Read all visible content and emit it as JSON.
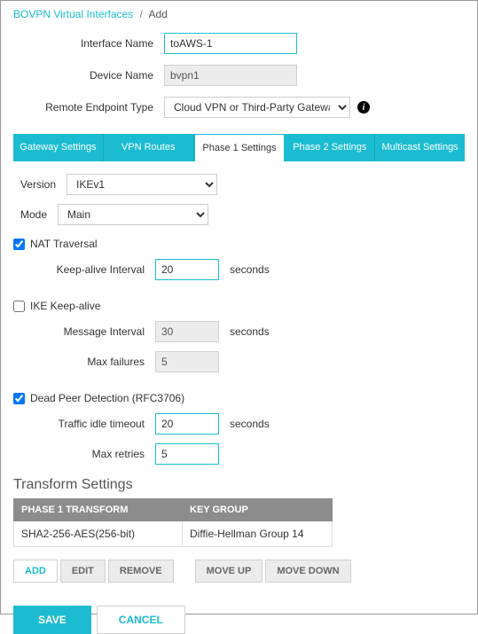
{
  "breadcrumb": {
    "root": "BOVPN Virtual Interfaces",
    "current": "Add"
  },
  "header_form": {
    "interface_name_label": "Interface Name",
    "interface_name_value": "toAWS-1",
    "device_name_label": "Device Name",
    "device_name_value": "bvpn1",
    "remote_endpoint_label": "Remote Endpoint Type",
    "remote_endpoint_value": "Cloud VPN or Third-Party Gateway"
  },
  "tabs": {
    "gateway": "Gateway Settings",
    "vpn_routes": "VPN Routes",
    "phase1": "Phase 1 Settings",
    "phase2": "Phase 2 Settings",
    "multicast": "Multicast Settings"
  },
  "phase1": {
    "version_label": "Version",
    "version_value": "IKEv1",
    "mode_label": "Mode",
    "mode_value": "Main",
    "nat_traversal": {
      "label": "NAT Traversal",
      "checked": true,
      "keep_alive_label": "Keep-alive Interval",
      "keep_alive_value": "20",
      "seconds": "seconds"
    },
    "ike_keepalive": {
      "label": "IKE Keep-alive",
      "checked": false,
      "message_interval_label": "Message Interval",
      "message_interval_value": "30",
      "max_failures_label": "Max failures",
      "max_failures_value": "5",
      "seconds": "seconds"
    },
    "dpd": {
      "label": "Dead Peer Detection (RFC3706)",
      "checked": true,
      "idle_timeout_label": "Traffic idle timeout",
      "idle_timeout_value": "20",
      "max_retries_label": "Max retries",
      "max_retries_value": "5",
      "seconds": "seconds"
    }
  },
  "transform": {
    "title": "Transform Settings",
    "col1": "PHASE 1 TRANSFORM",
    "col2": "KEY GROUP",
    "rows": [
      {
        "transform": "SHA2-256-AES(256-bit)",
        "keygroup": "Diffie-Hellman Group 14"
      }
    ],
    "buttons": {
      "add": "ADD",
      "edit": "EDIT",
      "remove": "REMOVE",
      "moveup": "MOVE UP",
      "movedown": "MOVE DOWN"
    }
  },
  "actions": {
    "save": "SAVE",
    "cancel": "CANCEL"
  }
}
